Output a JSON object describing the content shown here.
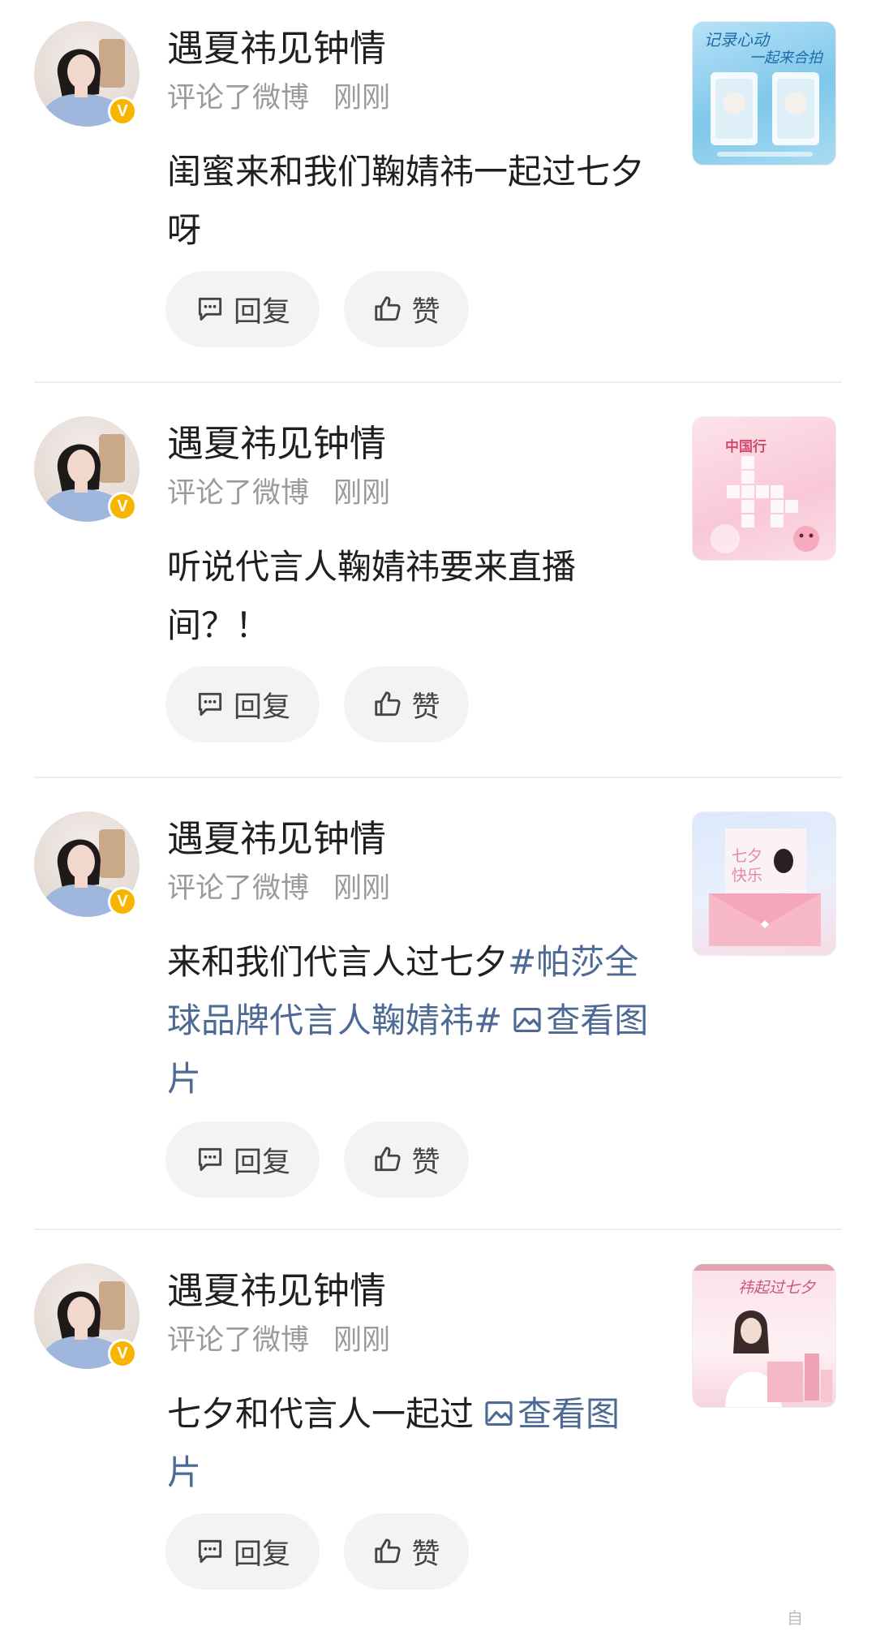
{
  "comments": [
    {
      "author": "遇夏祎见钟情",
      "action": "评论了微博",
      "time": "刚刚",
      "text": "闺蜜来和我们鞠婧祎一起过七夕呀",
      "thumb_caption_top": "记录心动",
      "thumb_caption_bottom": "一起来合拍"
    },
    {
      "author": "遇夏祎见钟情",
      "action": "评论了微博",
      "time": "刚刚",
      "text": "听说代言人鞠婧祎要来直播间？！",
      "thumb_caption_top": "中国行",
      "thumb_caption_bottom": ""
    },
    {
      "author": "遇夏祎见钟情",
      "action": "评论了微博",
      "time": "刚刚",
      "text": "来和我们代言人过七夕",
      "hashtag": "#帕莎全球品牌代言人鞠婧祎#",
      "image_link": "查看图片",
      "thumb_caption_top": "七夕",
      "thumb_caption_bottom": "快乐"
    },
    {
      "author": "遇夏祎见钟情",
      "action": "评论了微博",
      "time": "刚刚",
      "text": "七夕和代言人一起过",
      "image_link": "查看图片",
      "thumb_caption_top": "祎起过七夕",
      "thumb_caption_bottom": ""
    }
  ],
  "buttons": {
    "reply": "回复",
    "like": "赞"
  },
  "badge": "V",
  "watermark": "自",
  "colors": {
    "link": "#4c6a94",
    "badge": "#f7b500",
    "button_bg": "#f3f3f3"
  }
}
